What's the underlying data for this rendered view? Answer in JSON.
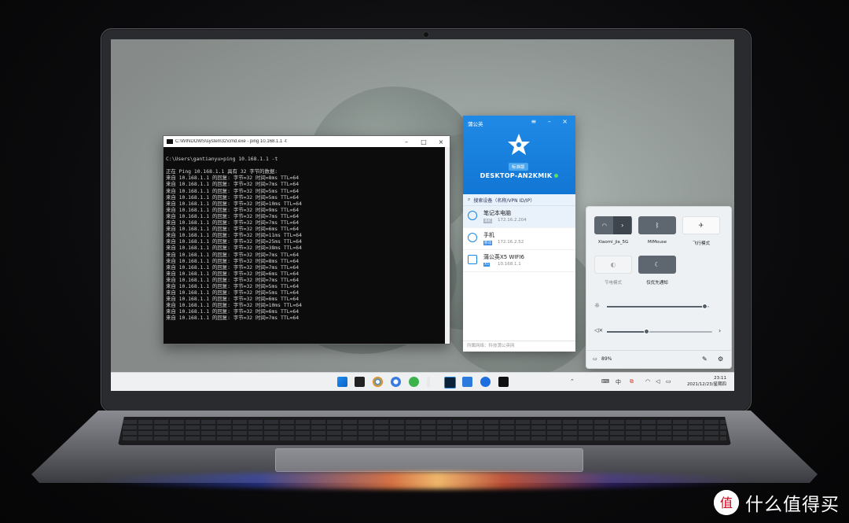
{
  "cmd": {
    "title": "C:\\WINDOWS\\system32\\cmd.exe - ping  10.168.1.1 -t",
    "lines": [
      "",
      "C:\\Users\\gantianyu>ping 10.168.1.1 -t",
      "",
      "正在 Ping 10.168.1.1 具有 32 字节的数据:",
      "来自 10.168.1.1 的回复: 字节=32 时间=8ms TTL=64",
      "来自 10.168.1.1 的回复: 字节=32 时间=7ms TTL=64",
      "来自 10.168.1.1 的回复: 字节=32 时间=5ms TTL=64",
      "来自 10.168.1.1 的回复: 字节=32 时间=5ms TTL=64",
      "来自 10.168.1.1 的回复: 字节=32 时间=10ms TTL=64",
      "来自 10.168.1.1 的回复: 字节=32 时间=9ms TTL=64",
      "来自 10.168.1.1 的回复: 字节=32 时间=7ms TTL=64",
      "来自 10.168.1.1 的回复: 字节=32 时间=7ms TTL=64",
      "来自 10.168.1.1 的回复: 字节=32 时间=6ms TTL=64",
      "来自 10.168.1.1 的回复: 字节=32 时间=11ms TTL=64",
      "来自 10.168.1.1 的回复: 字节=32 时间=25ms TTL=64",
      "来自 10.168.1.1 的回复: 字节=32 时间=38ms TTL=64",
      "来自 10.168.1.1 的回复: 字节=32 时间=7ms TTL=64",
      "来自 10.168.1.1 的回复: 字节=32 时间=8ms TTL=64",
      "来自 10.168.1.1 的回复: 字节=32 时间=7ms TTL=64",
      "来自 10.168.1.1 的回复: 字节=32 时间=6ms TTL=64",
      "来自 10.168.1.1 的回复: 字节=32 时间=7ms TTL=64",
      "来自 10.168.1.1 的回复: 字节=32 时间=5ms TTL=64",
      "来自 10.168.1.1 的回复: 字节=32 时间=5ms TTL=64",
      "来自 10.168.1.1 的回复: 字节=32 时间=6ms TTL=64",
      "来自 10.168.1.1 的回复: 字节=32 时间=10ms TTL=64",
      "来自 10.168.1.1 的回复: 字节=32 时间=6ms TTL=64",
      "来自 10.168.1.1 的回复: 字节=32 时间=7ms TTL=64"
    ]
  },
  "pgy": {
    "title": "蒲公英",
    "badge": "标准版",
    "device": "DESKTOP-AN2KMIK",
    "search_placeholder": "搜索设备（名称/VPN ID/IP）",
    "items": [
      {
        "name": "笔记本电脑",
        "tag": "本机",
        "ip": "172.16.2.204"
      },
      {
        "name": "手机",
        "tag": "移动",
        "ip": "172.16.2.52"
      },
      {
        "name": "蒲公英X5 WIFI6",
        "tag": "X5",
        "ip": "10.168.1.1"
      }
    ],
    "footer": "所属网络：科技蒲公英网",
    "colors": {
      "header": "#1a82e0",
      "online": "#5ee05e"
    }
  },
  "quick_settings": {
    "wifi_label": "Xiaomi_jia_5G",
    "bluetooth_label": "MiMouse",
    "airplane_label": "飞行模式",
    "battery_saver_label": "节电模式",
    "focus_label": "仅优先通知",
    "battery": "89%",
    "brightness": 0.96,
    "volume": 0.38
  },
  "taskbar": {
    "tray_lang": "中",
    "clock_time": "23:11",
    "clock_date": "2021/12/23/星期四"
  },
  "watermark": {
    "text": "什么值得买"
  }
}
